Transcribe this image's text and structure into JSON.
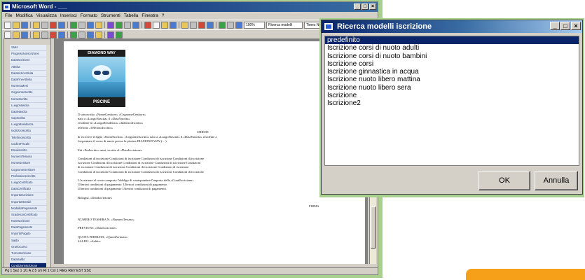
{
  "word": {
    "title": "Microsoft Word - ___",
    "menu": [
      "File",
      "Modifica",
      "Visualizza",
      "Inserisci",
      "Formato",
      "Strumenti",
      "Tabella",
      "Finestra",
      "?"
    ],
    "zoom": "100%",
    "combo1": "Ricerca modelli",
    "combo2": "Times New Roman",
    "fields": [
      "Stato",
      "ProgressivoIscrizione",
      "DataIscrizione",
      "Attivita",
      "DataInizioAttivita",
      "DataFineAttivita",
      "NumeroMesi",
      "CognomeIscritto",
      "NomeIscritto",
      "LuogoNascita",
      "DataNascita",
      "CapIscritto",
      "LuogoResidenza",
      "IndirizzoIscritto",
      "TelefonoIscritto",
      "CodiceFiscale",
      "EmailIscritto",
      "NumeroTessera",
      "NomeGenitore",
      "CognomeGenitore",
      "ProfessioneIscritto",
      "LuogoCertificato",
      "DataCertificato",
      "ImportoIscrizione",
      "ImportoMensile",
      "ModalitaPagamento",
      "ScadenzaCertificato",
      "NoteIscrizione",
      "DataPagamento",
      "ImportoPagato",
      "Saldo",
      "OrarioCorso",
      "TurnoIscrizione",
      "DataSaldo",
      "CondizioniIscrizione",
      "SaldoResiduo"
    ],
    "selected_field_index": 34,
    "logo_top": "DIAMOND WAY",
    "logo_bottom": "PISCINE",
    "doc_header": [
      "Il sottoscritto «NomeGenitore» «CognomeGenitore»",
      "nato a «LuogoNascita» il «DataNascita»",
      "residente in «LuogoResidenza» «IndirizzoIscritto»",
      "telefono «TelefonoIscritto»"
    ],
    "doc_chiede": "CHIEDE",
    "doc_body": [
      "di iscrivere il figlio «NomeIscritto» «CognomeIscritto» nato a «LuogoNascita» il «DataNascita» residente a",
      "frequentare il corso di nuoto presso la piscina DIAMOND WAY (…)",
      "",
      "Età «EtaIscritto» anni, iscritto al «DataIscrizione»",
      "",
      "Condizioni di iscrizione Condizioni di iscrizione Condizioni di iscrizione Condizioni di iscrizione",
      "iscrizione Condizioni di iscrizione Condizioni di iscrizione Condizioni di iscrizione Condizioni",
      "di iscrizione Condizioni di iscrizione Condizioni di iscrizione Condizioni di iscrizione",
      "Condizioni di iscrizione Condizioni di iscrizione Condizioni di iscrizione Condizioni di iscrizione",
      "",
      "L'iscrizione al corso comporta l'obbligo di corrispondere l'importo della «CondIscrizione»",
      "Ulteriori condizioni di pagamento. Ulteriori condizioni di pagamento.",
      "Ulteriori condizioni di pagamento Ulteriori condizioni di pagamento.",
      "",
      "Bologna, «DataIscrizione»",
      "",
      "FIRMA",
      "",
      "",
      "NUMERO TESSERA N. «NumeroTessera»",
      "",
      "PREVISTO: «DataIscrizione»",
      "",
      "QUOTA FERMATA: «QuotaFermata»",
      "SALDO: «Saldo»"
    ],
    "status": "Pg 1   Sez 1   1/1   A 2,5 cm   Ri 1   Col 1   REG  REV  EST  SSC"
  },
  "dialog": {
    "title": "Ricerca modelli iscrizione",
    "items": [
      "predefinito",
      "Iscrizione corsi di nuoto adulti",
      "Iscrizione corsi di nuoto bambini",
      "Iscrizione corsi",
      "Iscrizione ginnastica in acqua",
      "Iscrizione nuoto libero mattina",
      "Iscrizione nuoto libero sera",
      "Iscrizione",
      "Iscrizione2"
    ],
    "selected_index": 0,
    "ok_label": "OK",
    "cancel_label": "Annulla"
  },
  "colors": {
    "title_bar": "#0a246a",
    "frame_green": "#a9d08e",
    "orange_accent": "#f6a01a",
    "window_face": "#d4d0c8"
  }
}
